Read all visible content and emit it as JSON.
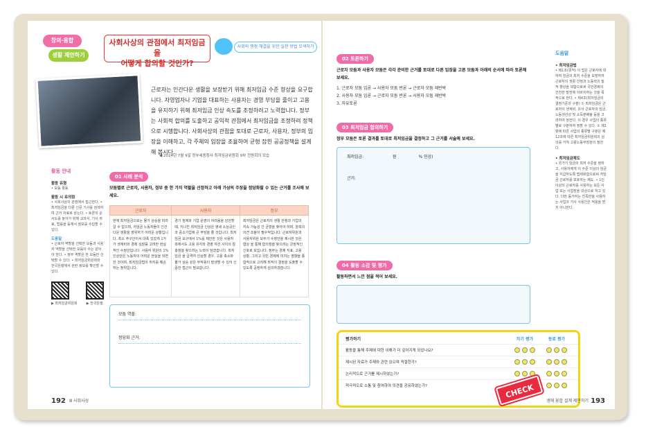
{
  "left": {
    "badge1": "창의·융합",
    "badge2": "생활 제안하기",
    "title_line1": "사회사상의 관점에서 최저임금을",
    "title_line2": "어떻게 합의할 것인가?",
    "subtitle": "사회의 쟁점 해결을 위한 실천 방법 모색하기",
    "intro": "근로자는 인간다운 생활을 보장받기 위해 최저임금 수준 향상을 요구합니다. 자영업자나 기업을 대표하는 사용자는 경영 부담을 줄이고 고용을 유지하기 위해 최저임금 인상 속도를 조정하려고 노력합니다. 정부는 사회적 합의를 도출하고 공익적 관점에서 최저임금을 조정하려 정책으로 시행합니다. 사회사상의 관점을 토대로 근로자, 사용자, 정부의 입장을 이해하고, 각 주체의 입장을 조율하여 균형 잡힌 공공정책을 설계해 봅시다.",
    "caption": "◀ 2024년 7월 9일 정부세종청사 최저임금위원회 9차 전원회의 모습",
    "sidebar": {
      "head": "활동 안내",
      "l1": "활동 유형",
      "t1": "• 모둠 활동",
      "l2": "활동 시 유의점",
      "t2": "• 사회사상의 관점에서 접근한다. • 최저임금을 다룬 신문 기사를 검색하여 근거 자료로 삼는다. • 토론의 순서도를 놓아가 위해 교과서, 기사 자료, 법률을 등재서 정보를 수집할 수 있다.",
      "l3": "도움말",
      "t3": "• 근로자 역할을 선택한 모둠과 사용자 역할을 선택한 모둠이 수는 같아야 한다. • 정부 역할은 한 모둠만 선택할 수 있다. • 최저임금위원회와 한국은행에서 관련 정보를 확인할 수 있다.",
      "qr1": "▶ 최저임금위원회",
      "qr2": "▶ 한국은행"
    },
    "sec1": {
      "label": "01 사례 분석",
      "desc": "모둠별로 근로자, 사용자, 정부 중 한 가지 역할을 선정하고 아래 가상의 주장을 정당화할 수 있는 근거를 조사해 보세요.",
      "cols": [
        "근로자",
        "사용자",
        "정부"
      ],
      "cells": [
        "현재 최저임금으로는 물가 상승을 따라갈 수 없으며, 저임금 노동자들이 인간다운 생활을 영위하기 어려운 상황입니다. 최소 주구안이서 대폭 있었게 1가가 생계비와 경제 성장률 고려한 현실적인 수정안입니다. 사용자 위원의 1% 인상안은 노동자의 어려운 현실을 외면한 것이며, 최저임금법의 취지를 훼손하는 정위입니다.",
        "경기 침체와 기업 운영의 어려움을 감안할 때, 지나친 최저임금 인상은 영세 소상공인과 중소기업에 큰 부담을 줄 것입니다. 최저임금 요구에서 1%를 제안한 것은 사용자 측에서도 고용 유지와 경영 여건 사이의 절충점을 찾으려는 노력이 담겼습니다. 최저임금 을 급격히 인상할 경우, 고용 축소와 물가 상승 같은 부작용이 발생할 수 있어 신중한 접근이 필요합니다.",
        "최저임금은 근로자의 생활 안정과 기업의 지속 가능성 간 균형을 찾아야 하며, 양측의 의견 조율이 필수적입니다. 근로자위원과 사용자위원 모두가 수정안을 제시한 것은 협상 을 통해 합의점을 찾으려는 긍정적인 신호로 보입니다. 정부는 경제 지표, 고용 상황, 그리고 국민 경제에 미치는 영향을 종합적으로 고려해 최적의 결정을 도출할 수 있도록 공정하게 심의하겠습니다."
      ],
      "answer_role": "모둠 역할:",
      "answer_reason": "정당화 근거:"
    },
    "page_no": "192",
    "footer": "Ⅲ 사회사상"
  },
  "right": {
    "sec2": {
      "label": "02 토론하기",
      "desc": "근로자 모둠과 사용자 모둠은 각각 준비한 근거를 토대로 다른 입장을 고른 모둠과 아래의 순서에 따라 토론해 보세요.",
      "items": [
        "1. 근로자 모둠 입론 → 사용자 모둠 반론 → 근로자 모둠 재반박",
        "2. 사용자 모둠 입론 → 근로자 모둠 반론 → 사용자 모둠 재반박",
        "3. 자유토론"
      ]
    },
    "sec3": {
      "label": "03 최저임금 합의하기",
      "desc": "정부 모둠은 토론 결과를 토대로 최저임금을 결정하고 그 근거를 서술해 보세요.",
      "field1": "최저임금:",
      "field1_unit": "원",
      "field1_pct": "% 인상)",
      "field2": "근거:"
    },
    "sec4": {
      "label": "04 활동 소감 및 평가",
      "desc": "활동하면서 느낀 점을 적어 보세요."
    },
    "side": {
      "head": "도움말",
      "l1": "• 최저임금법",
      "t1": "• 제1조(목적) 이 법은 근로자에 대하여 임금의 최저 수준을 보장하여 근로자의 생활 안정과 노동력의 질적 향상을 꾀함으로써 국민경제의 건전한 발전에 이바지하는 것을 목적으로 한다. • 제4조(최저임금의 결정기준과 구분) ① 최저임금은 근로자의 생계비, 유사 근로자의 임금, 노동생산성 및 소득분배율 등을 고려하여 정한다. 이 경우 사업의 종류별로 구분하여 정할 수 있다. ② 제1항에 따른 사업의 종류별 구분은 제12조에 따른 최저임금위원회의 심의를 거쳐 고용노동부장관이 정한다.",
      "l2": "• 최저임금제도",
      "t2": "• 국가가 임금의 최저 수준을 정하고, 사용자에게 이 수준 이상의 임금을 지급하도록 법제화함으로써 저임금 근로자를 보호하는 제도. • 1인 이상의 근로자를 사용하는 모든 사업 또는 사업장을 대상으로 하고 있다. 다만 동거하는 친족만을 사용하는 사업과 가사 사용인은 적용을 받지 아니한다."
    },
    "eval": {
      "head": "평가하기",
      "self": "자기 평가",
      "peer": "동료 평가",
      "rows": [
        "활동을 통해 주제에 대한 이해가 더 깊어지게 되었나요?",
        "제시된 자료가 주제와 관련 있으며 적절한가?",
        "논리적으로 근거를 제시하였는가?",
        "적극적으로 소통 및 참여하여 의견을 공유하였는가?"
      ]
    },
    "check": "CHECK",
    "page_no": "193",
    "footer": "생애 융합 설계 제안하기"
  }
}
